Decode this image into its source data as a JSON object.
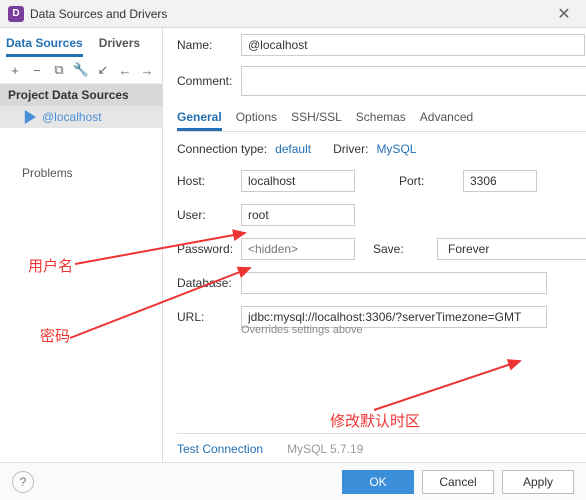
{
  "window": {
    "title": "Data Sources and Drivers"
  },
  "leftTabs": {
    "dataSources": "Data Sources",
    "drivers": "Drivers"
  },
  "tree": {
    "group": "Project Data Sources",
    "item": {
      "label": "@localhost"
    },
    "problems": "Problems"
  },
  "form": {
    "nameLabel": "Name:",
    "nameValue": "@localhost",
    "commentLabel": "Comment:"
  },
  "rightTabs": {
    "general": "General",
    "options": "Options",
    "sshssl": "SSH/SSL",
    "schemas": "Schemas",
    "advanced": "Advanced"
  },
  "conn": {
    "typeLabel": "Connection type:",
    "typeValue": "default",
    "driverLabel": "Driver:",
    "driverValue": "MySQL"
  },
  "fields": {
    "hostLabel": "Host:",
    "hostValue": "localhost",
    "portLabel": "Port:",
    "portValue": "3306",
    "userLabel": "User:",
    "userValue": "root",
    "passwordLabel": "Password:",
    "passwordPlaceholder": "<hidden>",
    "saveLabel": "Save:",
    "saveValue": "Forever",
    "databaseLabel": "Database:",
    "databaseValue": "",
    "urlLabel": "URL:",
    "urlValue": "jdbc:mysql://localhost:3306/?serverTimezone=GMT",
    "urlHint": "Overrides settings above"
  },
  "rfooter": {
    "test": "Test Connection",
    "version": "MySQL 5.7.19"
  },
  "footer": {
    "ok": "OK",
    "cancel": "Cancel",
    "apply": "Apply"
  },
  "annotations": {
    "user": "用户名",
    "password": "密码",
    "timezone": "修改默认时区"
  }
}
